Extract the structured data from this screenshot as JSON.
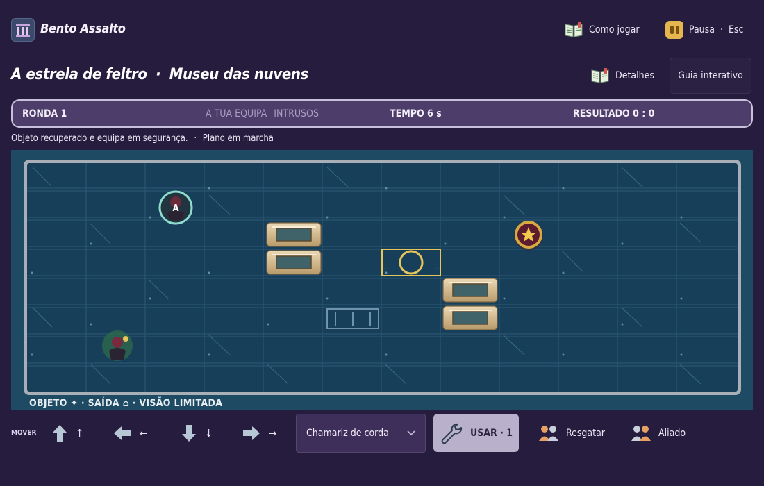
{
  "header": {
    "app_title": "Bento Assalto",
    "how_to_play": "Como jogar",
    "pause": "Pausa",
    "pause_sep": "·",
    "pause_key": "Esc"
  },
  "level": {
    "title": "A estrela de feltro",
    "sep": "·",
    "location": "Museu das nuvens",
    "details": "Detalhes",
    "guide": "Guia interativo"
  },
  "status": {
    "round": "RONDA  1",
    "team_a": "A TUA EQUIPA",
    "team_b": "INTRUSOS",
    "time": "TEMPO  6 s",
    "score": "RESULTADO  0 : 0",
    "message": "Objeto recuperado e equipa em segurança.",
    "message_sep": "·",
    "plan": "Plano em marcha"
  },
  "board": {
    "player_label": "A",
    "legend": "OBJETO ✦  ·  SAÍDA ⌂  ·  VISÃO LIMITADA"
  },
  "controls": {
    "move_label": "MOVER",
    "up": "↑",
    "left": "←",
    "down": "↓",
    "right": "→",
    "gadget_selected": "Chamariz de corda",
    "use_label": "USAR · 1",
    "rescue": "Resgatar",
    "ally": "Aliado"
  },
  "colors": {
    "background": "#261c3d",
    "status_bar": "#4c3d6a",
    "board": "#173f5a",
    "accent_gold": "#e6b64e"
  },
  "icons": {
    "logo": "museum-logo-icon",
    "book": "open-book-icon",
    "pause": "pause-icon",
    "wrench": "wrench-icon",
    "people": "people-icon",
    "chevron": "chevron-down-icon"
  }
}
